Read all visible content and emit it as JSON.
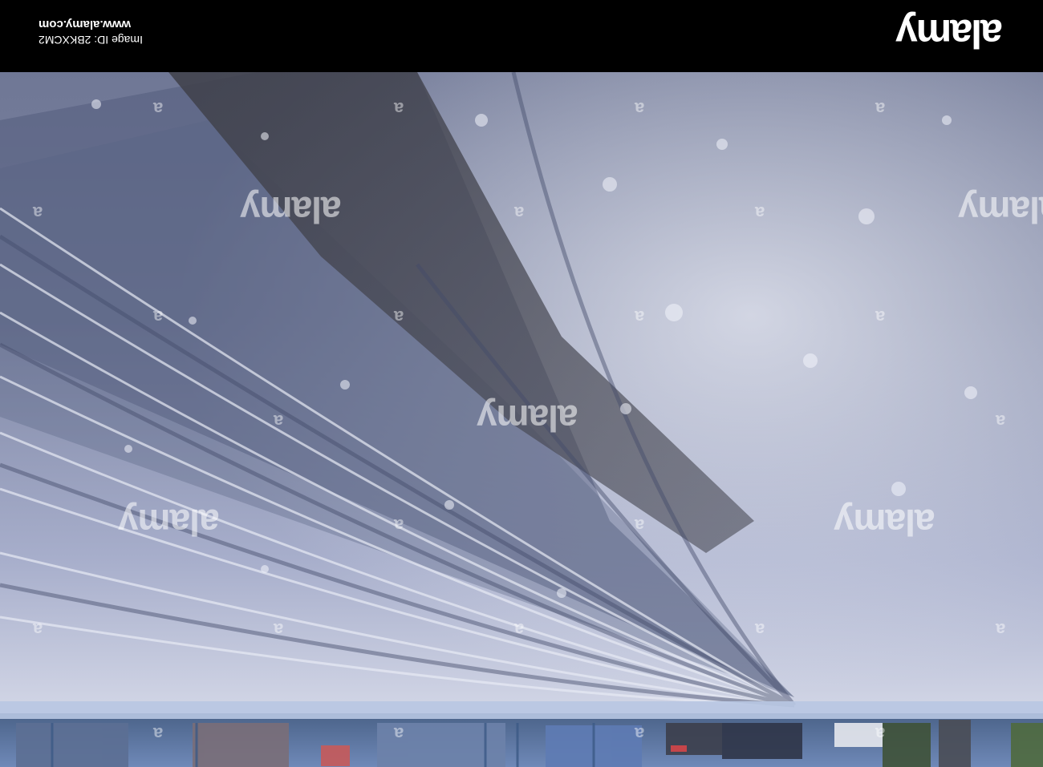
{
  "banner": {
    "logo": "alamy",
    "url": "www.alamy.com",
    "image_id": "Image ID: 2BKXCM2"
  },
  "watermark": {
    "logo": "alamy",
    "mark": "a"
  },
  "colors": {
    "banner": "#000000",
    "snow_light": "#e4e7f2",
    "snow_shadow": "#5a6280",
    "gravel": "#4a4a52"
  }
}
